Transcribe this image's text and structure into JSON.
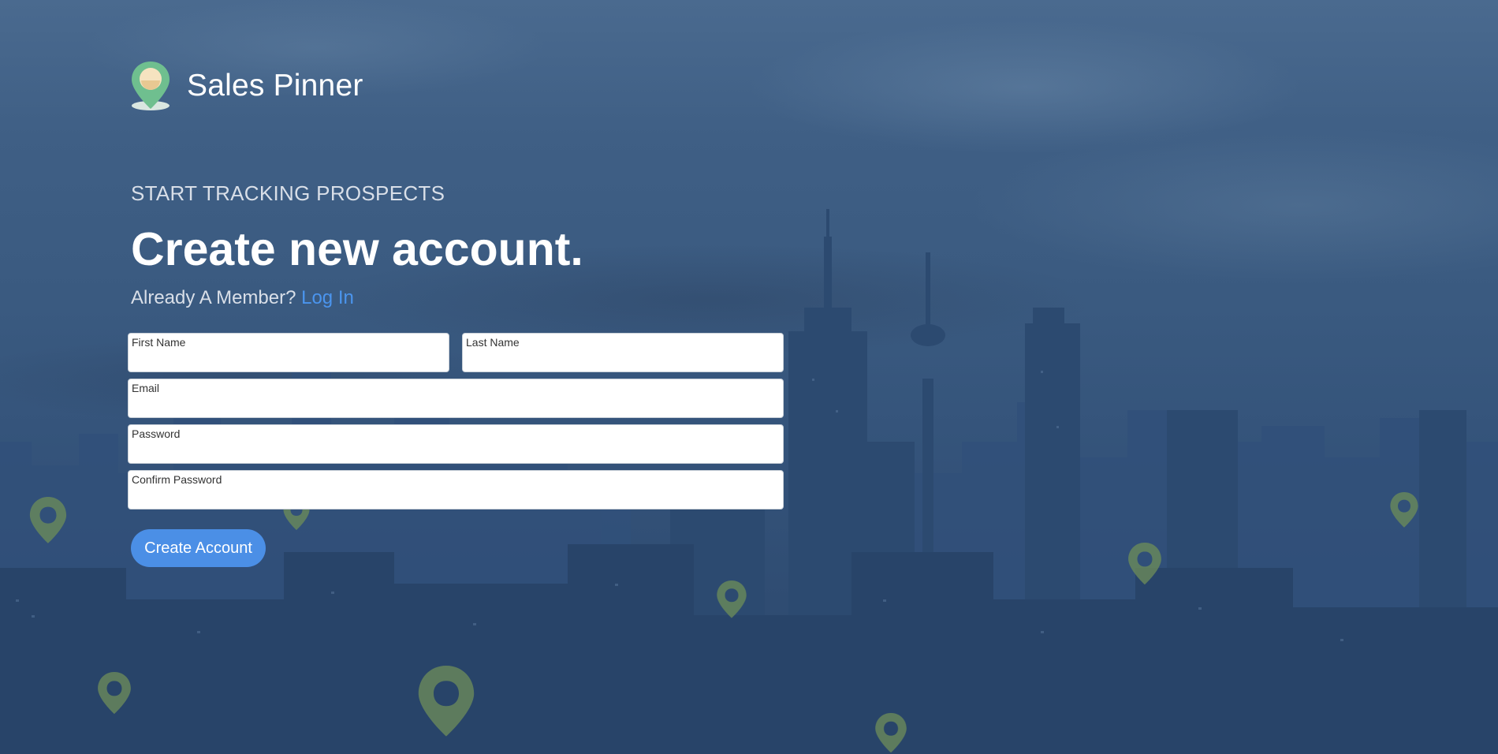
{
  "brand": {
    "name": "Sales Pinner",
    "logo_icon": "map-pin-logo-icon"
  },
  "hero": {
    "eyebrow": "START TRACKING PROSPECTS",
    "headline": "Create new account.",
    "member_prompt": "Already A Member?",
    "login_link": "Log In"
  },
  "form": {
    "first_name_label": "First Name",
    "first_name_value": "",
    "last_name_label": "Last Name",
    "last_name_value": "",
    "email_label": "Email",
    "email_value": "",
    "password_label": "Password",
    "password_value": "",
    "confirm_password_label": "Confirm Password",
    "confirm_password_value": "",
    "submit_label": "Create Account"
  },
  "colors": {
    "accent": "#4b8fe6",
    "link": "#4b95ee",
    "background": "#3a5a80",
    "pin": "#6b8a5a"
  }
}
